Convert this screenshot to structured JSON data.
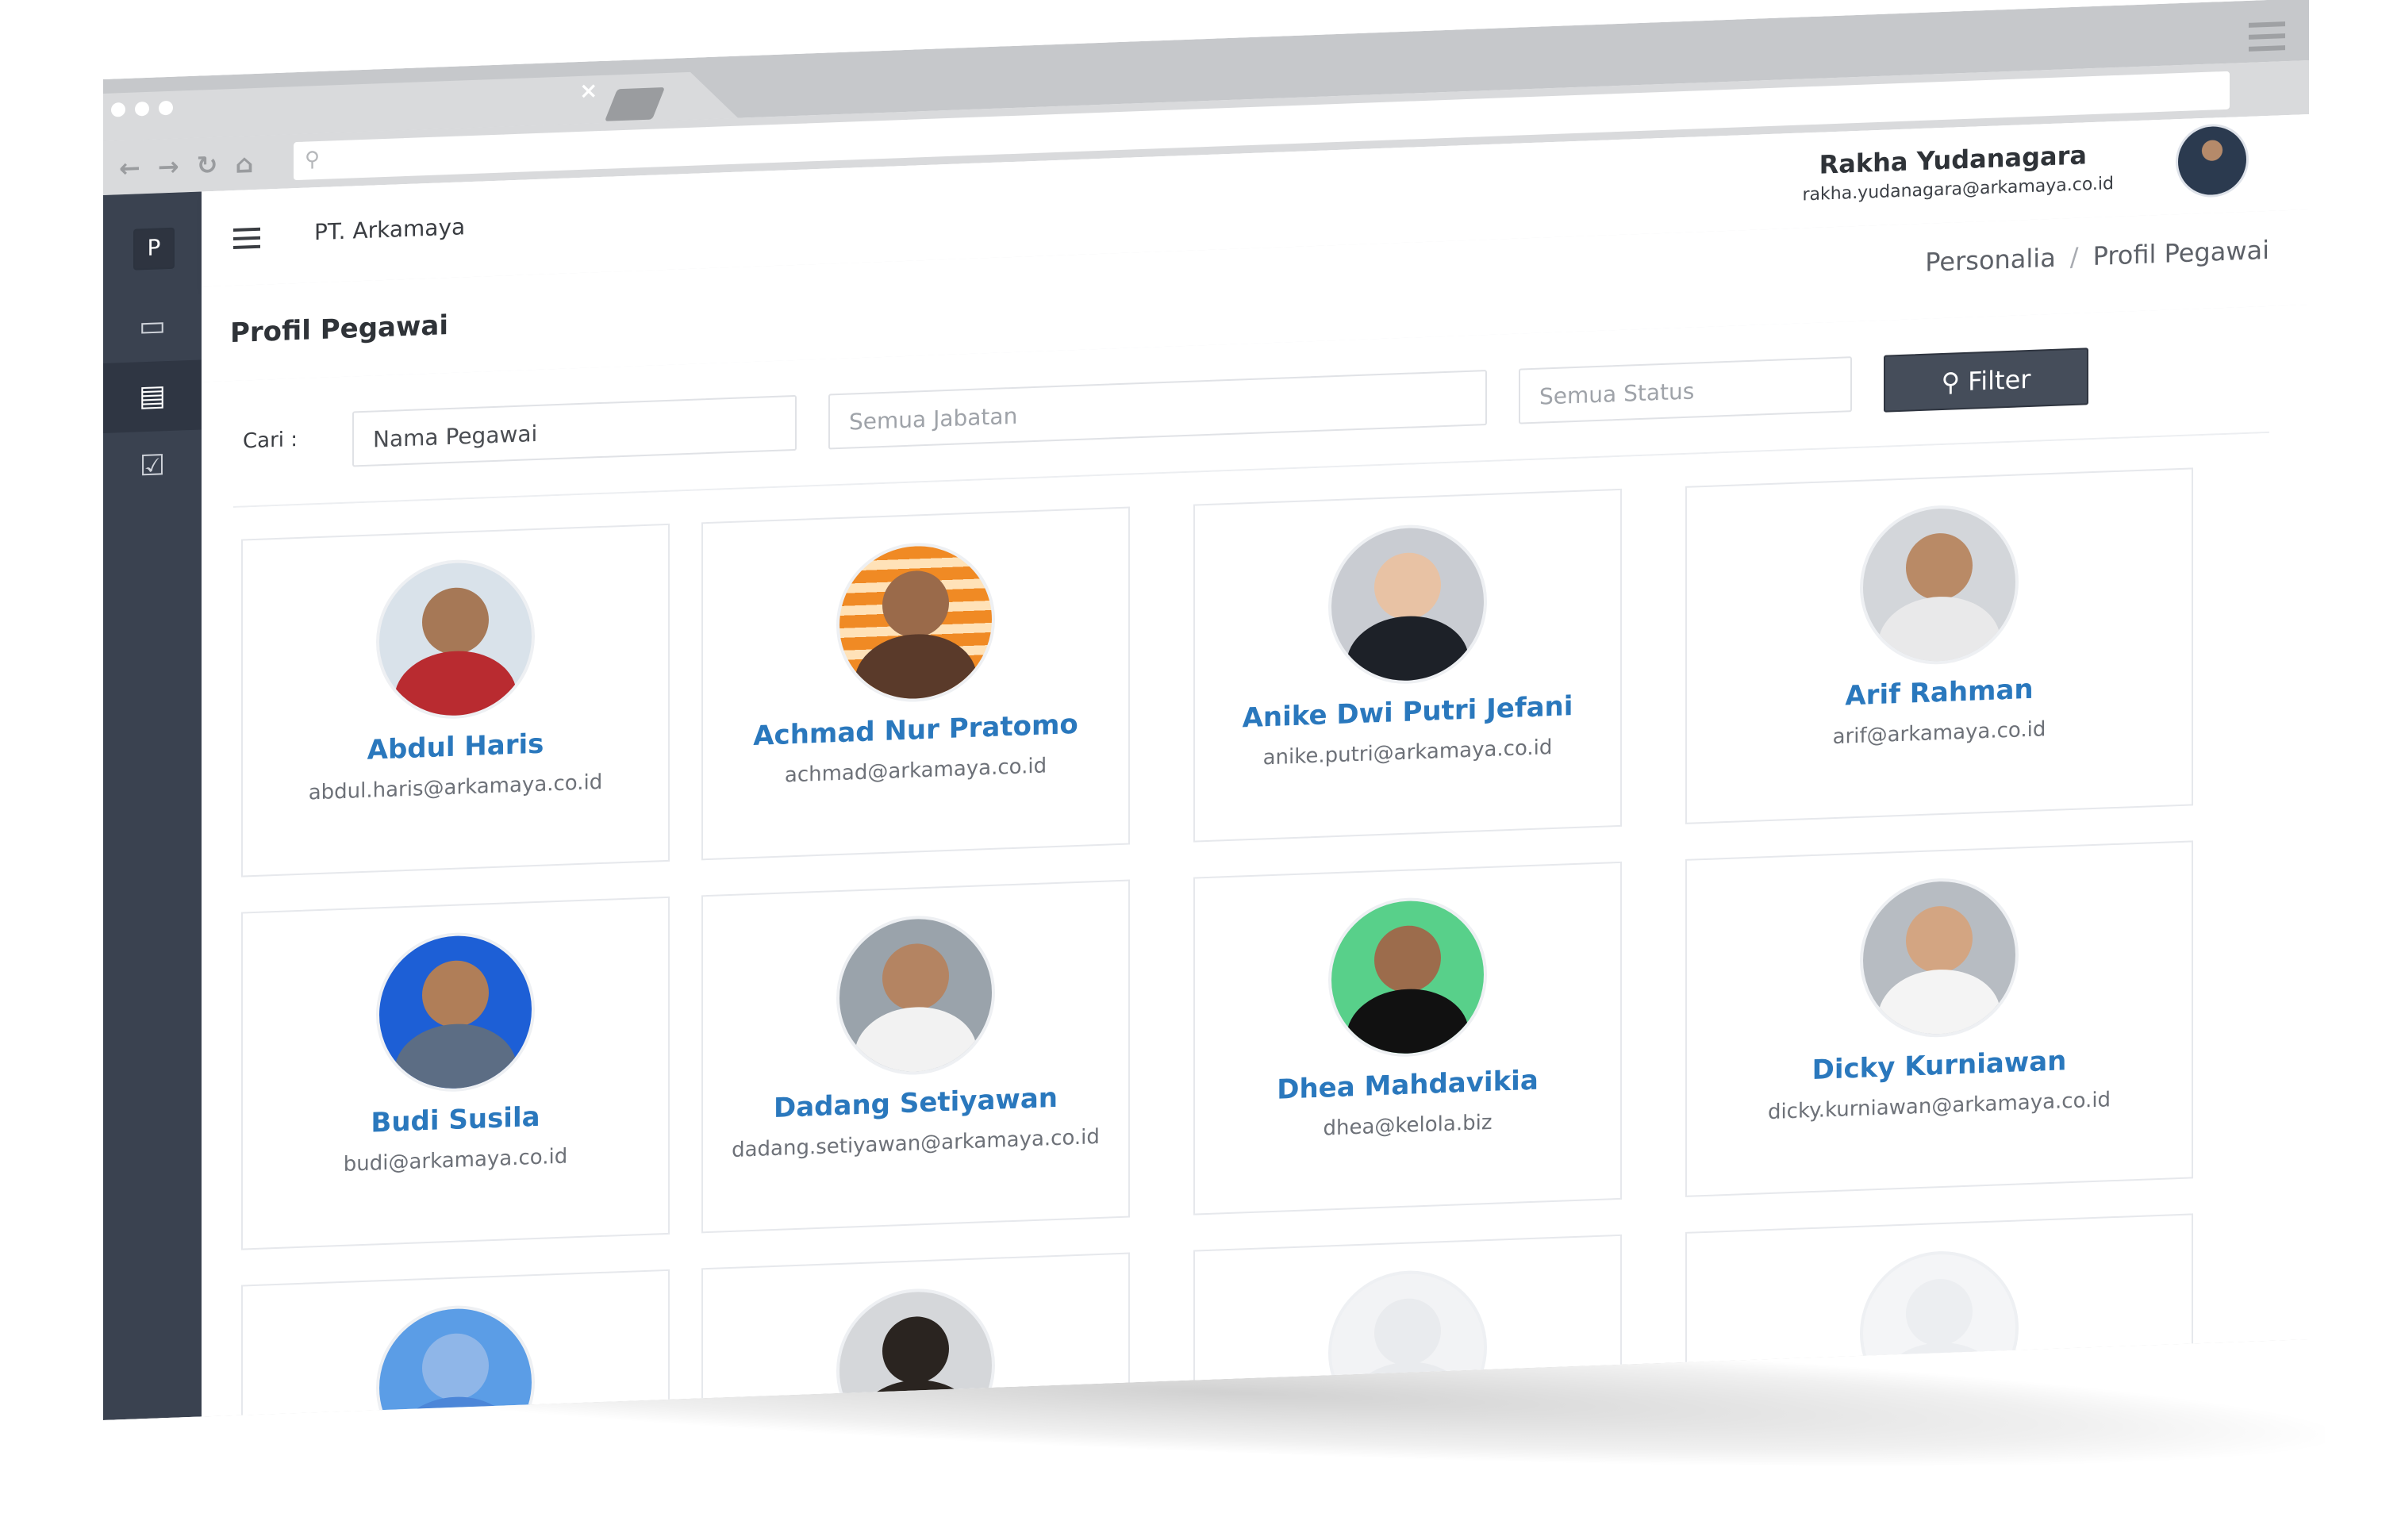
{
  "browser": {
    "tab_close_glyph": "×",
    "nav_icons": [
      "back-icon",
      "forward-icon",
      "reload-icon",
      "home-icon"
    ],
    "search_icon": "search-icon"
  },
  "header": {
    "sidebar_logo": "P",
    "company": "PT. Arkamaya",
    "user_name": "Rakha Yudanagara",
    "user_email": "rakha.yudanagara@arkamaya.co.id"
  },
  "sidebar": {
    "items": [
      {
        "icon": "id-card-icon",
        "active": false
      },
      {
        "icon": "clipboard-icon",
        "active": true
      },
      {
        "icon": "checklist-icon",
        "active": false
      }
    ]
  },
  "page": {
    "title": "Profil Pegawai",
    "breadcrumb": [
      "Personalia",
      "Profil Pegawai"
    ],
    "breadcrumb_sep": "/"
  },
  "filters": {
    "label": "Cari :",
    "nama_value": "Nama Pegawai",
    "jabatan_placeholder": "Semua Jabatan",
    "status_placeholder": "Semua Status",
    "filter_button": "Filter"
  },
  "employees": [
    {
      "name": "Abdul Haris",
      "email": "abdul.haris@arkamaya.co.id"
    },
    {
      "name": "Achmad Nur Pratomo",
      "email": "achmad@arkamaya.co.id"
    },
    {
      "name": "Anike Dwi Putri Jefani",
      "email": "anike.putri@arkamaya.co.id"
    },
    {
      "name": "Arif Rahman",
      "email": "arif@arkamaya.co.id"
    },
    {
      "name": "Budi Susila",
      "email": "budi@arkamaya.co.id"
    },
    {
      "name": "Dadang Setiyawan",
      "email": "dadang.setiyawan@arkamaya.co.id"
    },
    {
      "name": "Dhea Mahdavikia",
      "email": "dhea@kelola.biz"
    },
    {
      "name": "Dicky Kurniawan",
      "email": "dicky.kurniawan@arkamaya.co.id"
    }
  ],
  "colors": {
    "sidebar": "#3a4250",
    "accent_name": "#2a78bd",
    "filter_button": "#454d5a"
  }
}
